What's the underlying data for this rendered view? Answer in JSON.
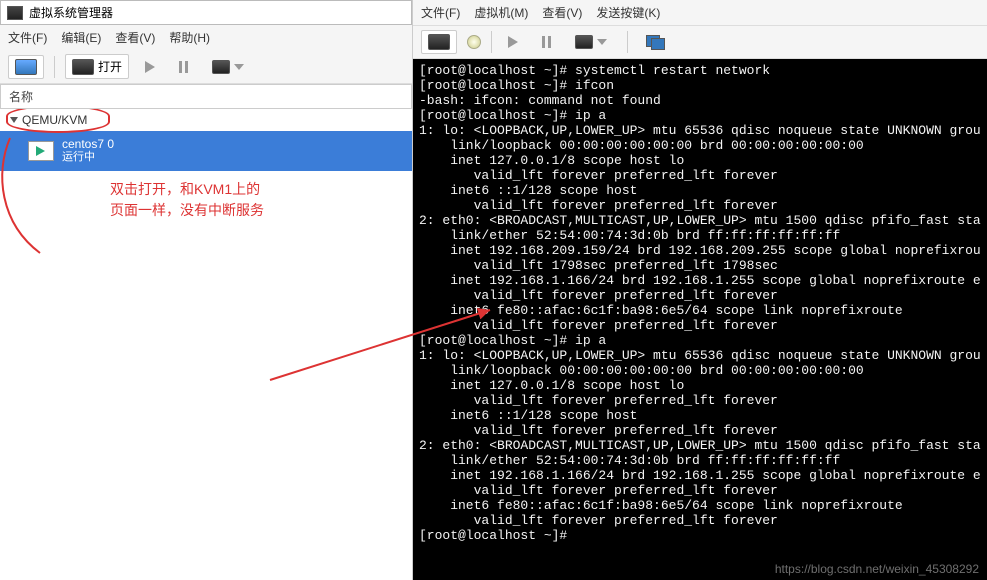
{
  "left": {
    "title": "虚拟系统管理器",
    "menus": [
      "文件(F)",
      "编辑(E)",
      "查看(V)",
      "帮助(H)"
    ],
    "toolbar_open": "打开",
    "column_header": "名称",
    "tree_root": "QEMU/KVM",
    "vm_name": "centos7 0",
    "vm_status": "运行中",
    "annotation_line1": "双击打开，和KVM1上的",
    "annotation_line2": "页面一样，没有中断服务"
  },
  "right": {
    "menus": [
      "文件(F)",
      "虚拟机(M)",
      "查看(V)",
      "发送按键(K)"
    ],
    "terminal_lines": [
      "[root@localhost ~]# systemctl restart network",
      "[root@localhost ~]# ifcon",
      "-bash: ifcon: command not found",
      "[root@localhost ~]# ip a",
      "1: lo: <LOOPBACK,UP,LOWER_UP> mtu 65536 qdisc noqueue state UNKNOWN grou",
      "    link/loopback 00:00:00:00:00:00 brd 00:00:00:00:00:00",
      "    inet 127.0.0.1/8 scope host lo",
      "       valid_lft forever preferred_lft forever",
      "    inet6 ::1/128 scope host",
      "       valid_lft forever preferred_lft forever",
      "2: eth0: <BROADCAST,MULTICAST,UP,LOWER_UP> mtu 1500 qdisc pfifo_fast sta",
      "    link/ether 52:54:00:74:3d:0b brd ff:ff:ff:ff:ff:ff",
      "    inet 192.168.209.159/24 brd 192.168.209.255 scope global noprefixrou",
      "       valid_lft 1798sec preferred_lft 1798sec",
      "    inet 192.168.1.166/24 brd 192.168.1.255 scope global noprefixroute e",
      "       valid_lft forever preferred_lft forever",
      "    inet6 fe80::afac:6c1f:ba98:6e5/64 scope link noprefixroute",
      "       valid_lft forever preferred_lft forever",
      "[root@localhost ~]# ip a",
      "1: lo: <LOOPBACK,UP,LOWER_UP> mtu 65536 qdisc noqueue state UNKNOWN grou",
      "    link/loopback 00:00:00:00:00:00 brd 00:00:00:00:00:00",
      "    inet 127.0.0.1/8 scope host lo",
      "       valid_lft forever preferred_lft forever",
      "    inet6 ::1/128 scope host",
      "       valid_lft forever preferred_lft forever",
      "2: eth0: <BROADCAST,MULTICAST,UP,LOWER_UP> mtu 1500 qdisc pfifo_fast sta",
      "    link/ether 52:54:00:74:3d:0b brd ff:ff:ff:ff:ff:ff",
      "    inet 192.168.1.166/24 brd 192.168.1.255 scope global noprefixroute e",
      "       valid_lft forever preferred_lft forever",
      "    inet6 fe80::afac:6c1f:ba98:6e5/64 scope link noprefixroute",
      "       valid_lft forever preferred_lft forever",
      "[root@localhost ~]# "
    ]
  },
  "watermark": "https://blog.csdn.net/weixin_45308292"
}
